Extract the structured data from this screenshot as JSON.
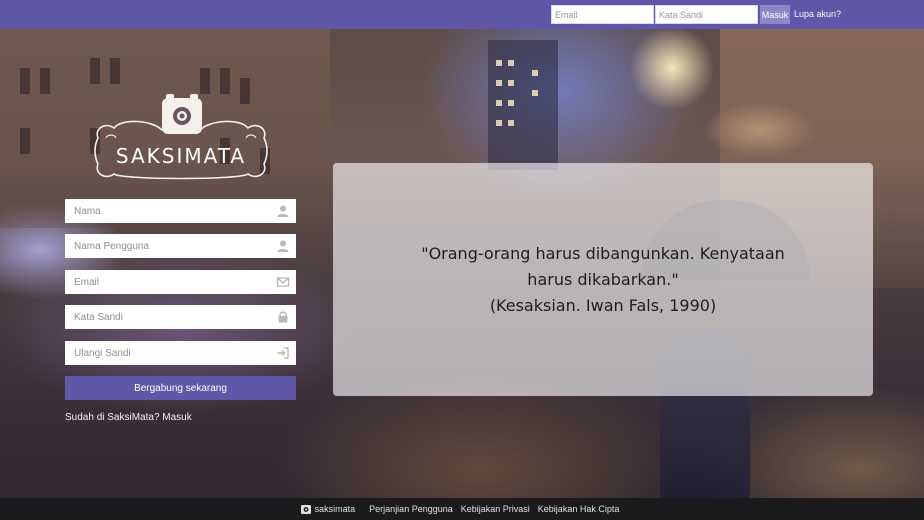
{
  "topbar": {
    "email_placeholder": "Email",
    "password_placeholder": "Kata Sandi",
    "login_label": "Masuk",
    "forgot_label": "Lupa akun?"
  },
  "logo": {
    "text": "SAKSIMATA"
  },
  "signup": {
    "name_placeholder": "Nama",
    "username_placeholder": "Nama Pengguna",
    "email_placeholder": "Email",
    "password_placeholder": "Kata Sandi",
    "repeat_password_placeholder": "Ulangi Sandi",
    "join_label": "Bergabung sekarang",
    "already_label": "Sudah di SaksiMata? Masuk"
  },
  "quote": {
    "line1": "\"Orang-orang harus dibangunkan. Kenyataan",
    "line2": "harus dikabarkan.\"",
    "line3": "(Kesaksian. Iwan Fals, 1990)"
  },
  "footer": {
    "brand": "saksimata",
    "links": [
      "Perjanjian Pengguna",
      "Kebijakan Privasi",
      "Kebijakan Hak Cipta"
    ]
  },
  "colors": {
    "brand_purple": "#6157a8",
    "login_button": "#8e86c6",
    "footer_bg": "#1b1b1d"
  },
  "icons": {
    "name": "user-icon",
    "username": "user-icon",
    "email": "envelope-icon",
    "password": "lock-icon",
    "repeat_password": "sign-in-icon"
  }
}
